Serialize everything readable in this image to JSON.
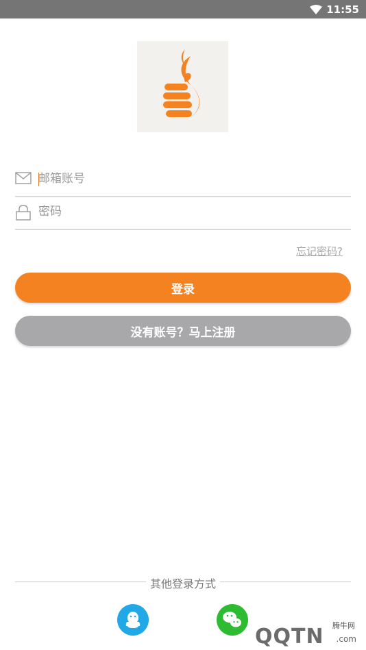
{
  "status_bar": {
    "time": "11:55",
    "icons": [
      "wifi-icon"
    ]
  },
  "logo": {
    "icon": "thumbs-up-flame-logo",
    "colors": {
      "background": "#f3f1ee",
      "mark": "#f48220"
    }
  },
  "form": {
    "email": {
      "placeholder": "邮箱账号",
      "icon": "envelope-icon"
    },
    "password": {
      "placeholder": "密码",
      "icon": "lock-icon"
    }
  },
  "forgot_password": "忘记密码?",
  "buttons": {
    "login": "登录",
    "register": "没有账号？马上注册"
  },
  "other_login": {
    "label": "其他登录方式",
    "providers": [
      {
        "name": "qq",
        "icon": "qq-icon",
        "color": "#21a8e6"
      },
      {
        "name": "wechat",
        "icon": "wechat-icon",
        "color": "#2dbb32"
      }
    ]
  },
  "watermark": {
    "brand": "QQTN",
    "site_label": "腾牛网",
    "suffix": ".com"
  },
  "colors": {
    "accent": "#f48220",
    "secondary_button": "#a8a8ab",
    "status_bar": "#757575"
  }
}
